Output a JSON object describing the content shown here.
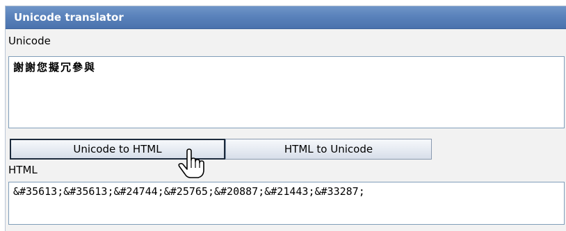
{
  "window": {
    "title": "Unicode translator"
  },
  "unicode_section": {
    "label": "Unicode",
    "value": "謝謝您擬冗參與"
  },
  "buttons": {
    "unicode_to_html": "Unicode to HTML",
    "html_to_unicode": "HTML to Unicode"
  },
  "html_section": {
    "label": "HTML",
    "value": "&#35613;&#35613;&#24744;&#25765;&#20887;&#21443;&#33287;"
  },
  "cursor": {
    "icon": "hand-pointer-icon"
  },
  "colors": {
    "titlebar": "#5a82bb",
    "panel_bg": "#f2f2f2",
    "field_border": "#7f9db9"
  }
}
